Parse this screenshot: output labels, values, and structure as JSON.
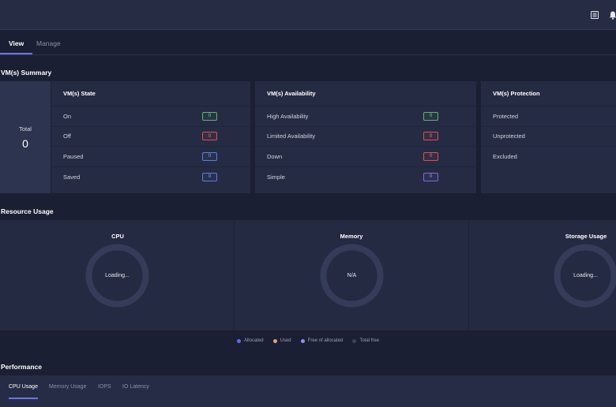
{
  "header": {
    "icons": [
      "list-icon",
      "bell-icon"
    ]
  },
  "tabs": [
    {
      "label": "View",
      "active": true
    },
    {
      "label": "Manage",
      "active": false
    }
  ],
  "vm_summary": {
    "title": "VM(s) Summary",
    "total_label": "Total",
    "total_value": "0",
    "state": {
      "title": "VM(s) State",
      "rows": [
        {
          "label": "On",
          "value": "0",
          "color": "green"
        },
        {
          "label": "Off",
          "value": "0",
          "color": "red"
        },
        {
          "label": "Paused",
          "value": "0",
          "color": "blue"
        },
        {
          "label": "Saved",
          "value": "0",
          "color": "blue"
        }
      ]
    },
    "availability": {
      "title": "VM(s) Availability",
      "rows": [
        {
          "label": "High Availability",
          "value": "0",
          "color": "green"
        },
        {
          "label": "Limited Availability",
          "value": "0",
          "color": "red"
        },
        {
          "label": "Down",
          "value": "0",
          "color": "red"
        },
        {
          "label": "Simple",
          "value": "0",
          "color": "purple"
        }
      ]
    },
    "protection": {
      "title": "VM(s) Protection",
      "rows": [
        {
          "label": "Protected"
        },
        {
          "label": "Unprotected"
        },
        {
          "label": "Excluded"
        }
      ]
    }
  },
  "resource_usage": {
    "title": "Resource Usage",
    "panels": [
      {
        "title": "CPU",
        "status": "Loading..."
      },
      {
        "title": "Memory",
        "status": "N/A"
      },
      {
        "title": "Storage Usage",
        "status": "Loading..."
      }
    ],
    "legend": [
      {
        "label": "Allocated",
        "color": "#5b6ef0"
      },
      {
        "label": "Used",
        "color": "#e8a07a"
      },
      {
        "label": "Free of allocated",
        "color": "#8b8ff5"
      },
      {
        "label": "Total free",
        "color": "#3b4260"
      }
    ]
  },
  "performance": {
    "title": "Performance",
    "tabs": [
      {
        "label": "CPU Usage",
        "active": true
      },
      {
        "label": "Memory Usage",
        "active": false
      },
      {
        "label": "IOPS",
        "active": false
      },
      {
        "label": "IO Latency",
        "active": false
      }
    ]
  },
  "colors": {
    "accent": "#6d75e8",
    "background": "#1a1f33",
    "card": "#252b43",
    "donut_ring": "#353c5a"
  }
}
